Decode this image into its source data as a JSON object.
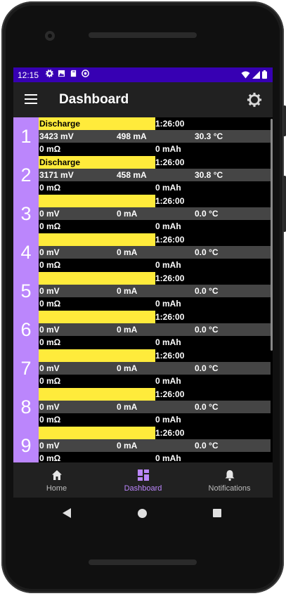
{
  "statusbar": {
    "time": "12:15"
  },
  "appbar": {
    "title": "Dashboard"
  },
  "cells": [
    {
      "index": "1",
      "state": "Discharge",
      "timer": "1:26:00",
      "voltage": "3423 mV",
      "current": "498 mA",
      "temperature": "30.3 °C",
      "resistance": "0 mΩ",
      "capacity": "0 mAh"
    },
    {
      "index": "2",
      "state": "Discharge",
      "timer": "1:26:00",
      "voltage": "3171 mV",
      "current": "458 mA",
      "temperature": "30.8 °C",
      "resistance": "0 mΩ",
      "capacity": "0 mAh"
    },
    {
      "index": "3",
      "state": "",
      "timer": "1:26:00",
      "voltage": "0 mV",
      "current": "0 mA",
      "temperature": "0.0 °C",
      "resistance": "0 mΩ",
      "capacity": "0 mAh"
    },
    {
      "index": "4",
      "state": "",
      "timer": "1:26:00",
      "voltage": "0 mV",
      "current": "0 mA",
      "temperature": "0.0 °C",
      "resistance": "0 mΩ",
      "capacity": "0 mAh"
    },
    {
      "index": "5",
      "state": "",
      "timer": "1:26:00",
      "voltage": "0 mV",
      "current": "0 mA",
      "temperature": "0.0 °C",
      "resistance": "0 mΩ",
      "capacity": "0 mAh"
    },
    {
      "index": "6",
      "state": "",
      "timer": "1:26:00",
      "voltage": "0 mV",
      "current": "0 mA",
      "temperature": "0.0 °C",
      "resistance": "0 mΩ",
      "capacity": "0 mAh"
    },
    {
      "index": "7",
      "state": "",
      "timer": "1:26:00",
      "voltage": "0 mV",
      "current": "0 mA",
      "temperature": "0.0 °C",
      "resistance": "0 mΩ",
      "capacity": "0 mAh"
    },
    {
      "index": "8",
      "state": "",
      "timer": "1:26:00",
      "voltage": "0 mV",
      "current": "0 mA",
      "temperature": "0.0 °C",
      "resistance": "0 mΩ",
      "capacity": "0 mAh"
    },
    {
      "index": "9",
      "state": "",
      "timer": "1:26:00",
      "voltage": "0 mV",
      "current": "0 mA",
      "temperature": "0.0 °C",
      "resistance": "0 mΩ",
      "capacity": "0 mAh"
    }
  ],
  "bottom_nav": [
    {
      "label": "Home",
      "icon": "home-icon"
    },
    {
      "label": "Dashboard",
      "icon": "dashboard-icon",
      "active": true
    },
    {
      "label": "Notifications",
      "icon": "bell-icon"
    }
  ],
  "colors": {
    "accent": "#bb86fc",
    "status_bar": "#3700b3",
    "state_bar": "#ffeb3b"
  }
}
